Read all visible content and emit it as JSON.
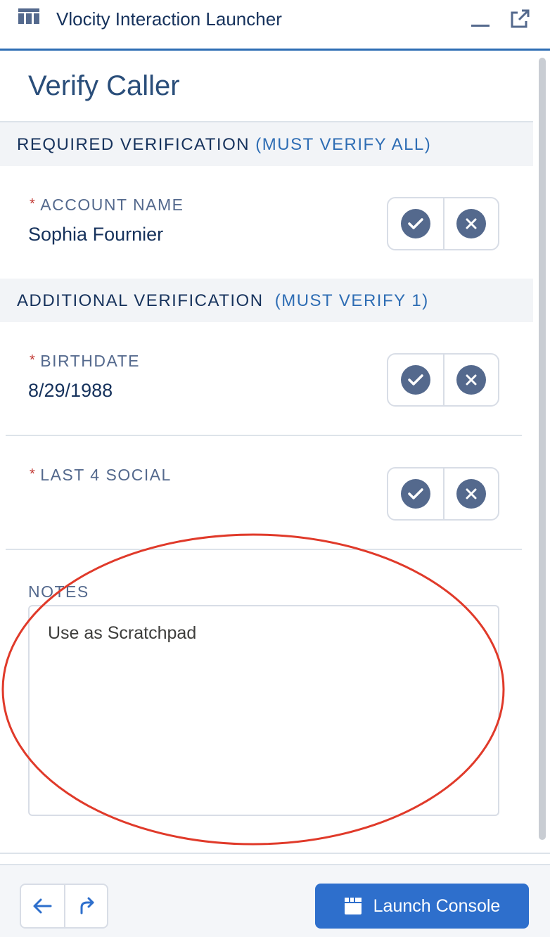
{
  "window": {
    "title": "Vlocity Interaction Launcher",
    "icons": {
      "app": "table-icon",
      "minimize": "minimize-icon",
      "popout": "popout-icon"
    }
  },
  "page": {
    "title": "Verify Caller"
  },
  "required_section": {
    "label": "REQUIRED VERIFICATION",
    "requirement": "(MUST VERIFY ALL)",
    "fields": [
      {
        "label": "ACCOUNT NAME",
        "value": "Sophia Fournier"
      }
    ]
  },
  "additional_section": {
    "label": "ADDITIONAL VERIFICATION",
    "requirement": "(MUST VERIFY  1)",
    "fields": [
      {
        "label": "BIRTHDATE",
        "value": "8/29/1988"
      },
      {
        "label": "LAST 4 SOCIAL",
        "value": ""
      }
    ]
  },
  "required_marker": "*",
  "notes": {
    "label": "NOTES",
    "value": "Use as Scratchpad"
  },
  "footer": {
    "launch_label": "Launch Console",
    "icons": {
      "back": "arrow-left-icon",
      "redo": "redo-icon",
      "launch": "console-icon"
    }
  },
  "colors": {
    "accent": "#2e6fcc",
    "header_text": "#2a4e7a",
    "verify_circle": "#54698d",
    "required_star": "#c23934",
    "annotation": "#e03a2a"
  }
}
